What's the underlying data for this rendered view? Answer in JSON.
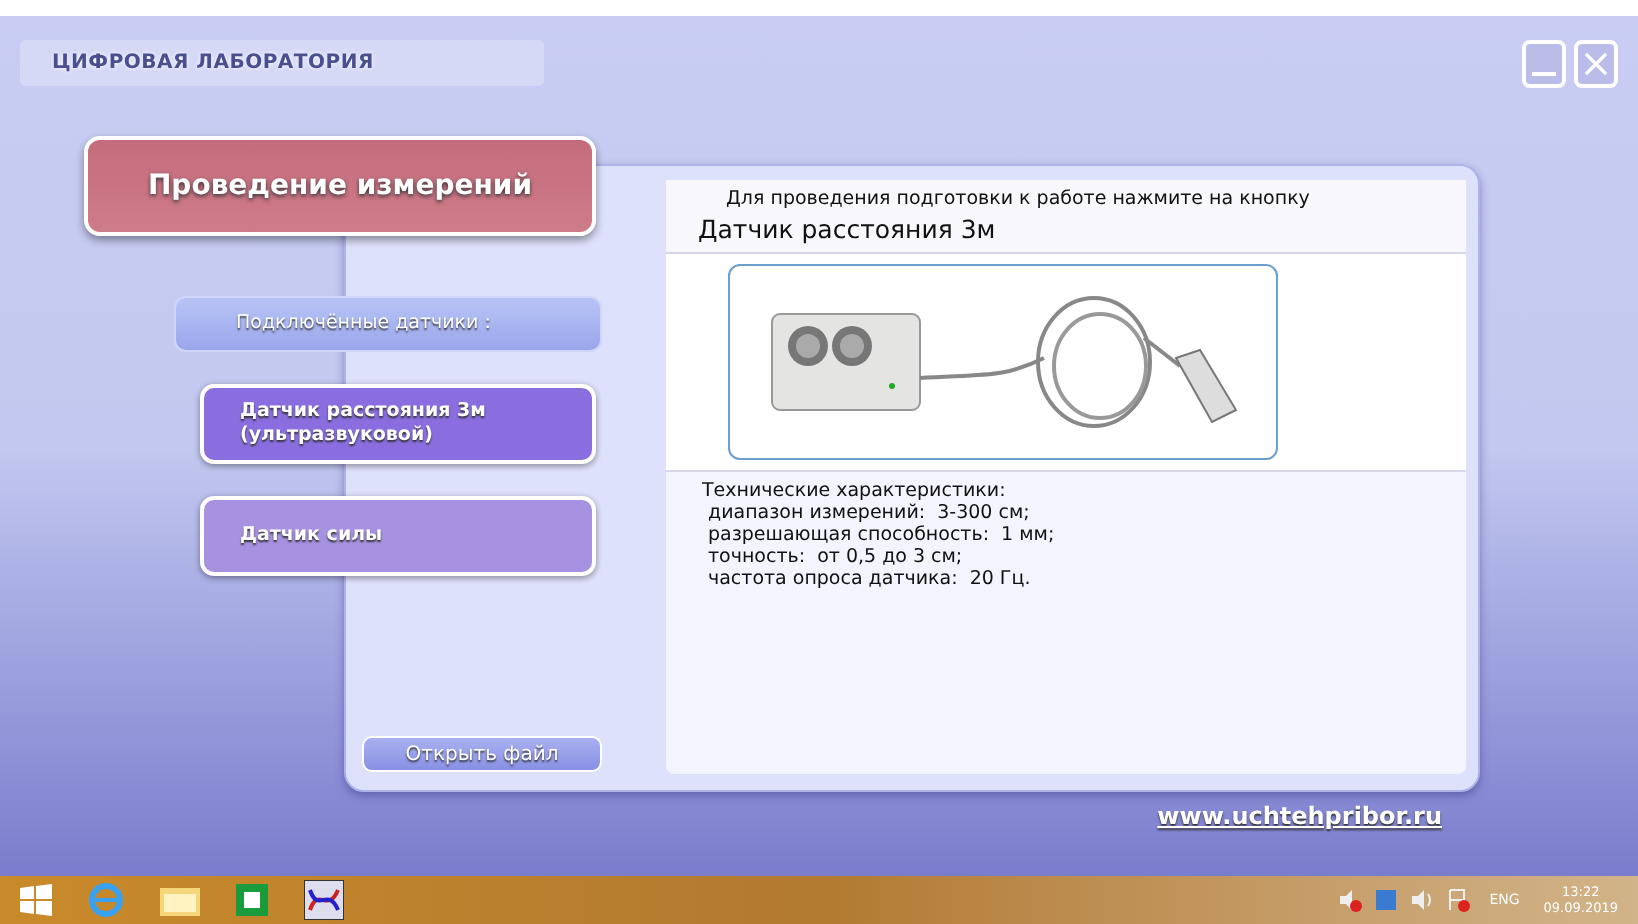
{
  "app_title": "ЦИФРОВАЯ ЛАБОРАТОРИЯ",
  "window_buttons": [
    {
      "kind": "minimize"
    },
    {
      "kind": "close"
    }
  ],
  "mode_button": "Проведение измерений",
  "sidebar": {
    "header": "Подключённые датчики :",
    "sensors": [
      {
        "label": "Датчик расстояния 3м (ультразвуковой)",
        "selected": true
      },
      {
        "label": "Датчик силы",
        "selected": false
      }
    ],
    "open_file": "Открыть файл"
  },
  "content": {
    "hint": "Для проведения подготовки к работе нажмите на кнопку",
    "sensor_name": "Датчик расстояния 3м",
    "specs_title": "Технические характеристики:",
    "specs": [
      {
        "name": "диапазон измерений:",
        "value": "3-300 см;"
      },
      {
        "name": "разрешающая способность:",
        "value": "1 мм;"
      },
      {
        "name": "точность:",
        "value": "от 0,5 до 3 см;"
      },
      {
        "name": "частота опроса датчика:",
        "value": "20 Гц."
      }
    ]
  },
  "site_link": "www.uchtehpribor.ru",
  "taskbar": {
    "tray_language": "ENG",
    "time": "13:22",
    "date": "09.09.2019"
  }
}
